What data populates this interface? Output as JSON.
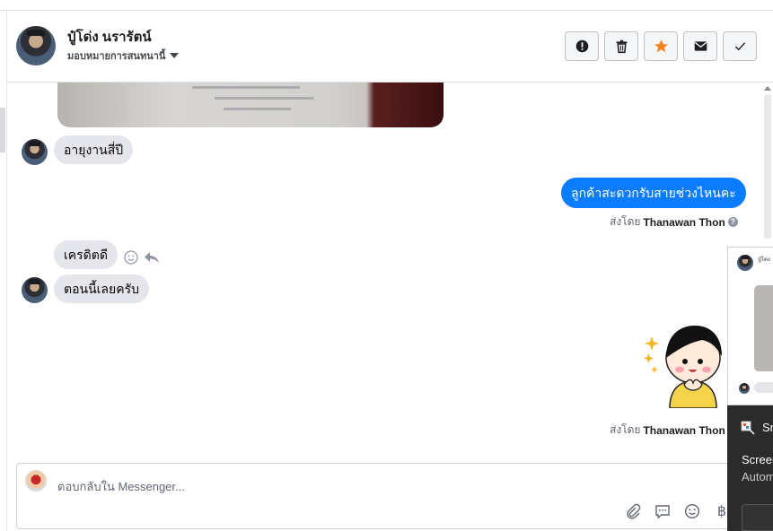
{
  "header": {
    "name": "ปู๋โด่ง นรารัตน์",
    "assign_label": "มอบหมายการสนทนานี้"
  },
  "actions": [
    {
      "name": "report-button",
      "icon": "alert-icon"
    },
    {
      "name": "delete-button",
      "icon": "trash-icon"
    },
    {
      "name": "star-button",
      "icon": "star-icon"
    },
    {
      "name": "mail-button",
      "icon": "envelope-icon"
    },
    {
      "name": "done-button",
      "icon": "check-icon"
    }
  ],
  "messages": {
    "in_1": "อายุงานสี่ปี",
    "out_1": "ลูกค้าสะดวกรับสายช่วงไหนคะ",
    "in_2": "เครดิตดี",
    "in_3": "ตอนนี้เลยครับ"
  },
  "sent_by": {
    "prefix": "ส่งโดย",
    "agent": "Thanawan Thon"
  },
  "composer": {
    "placeholder": "ตอบกลับใน Messenger..."
  },
  "overlay": {
    "title_partial": "Sn",
    "line_1": "Screen",
    "line_2": "Autom"
  },
  "colors": {
    "accent_blue": "#0a7cff",
    "star_orange": "#f5821f",
    "incoming_bubble": "#e4e6eb"
  }
}
